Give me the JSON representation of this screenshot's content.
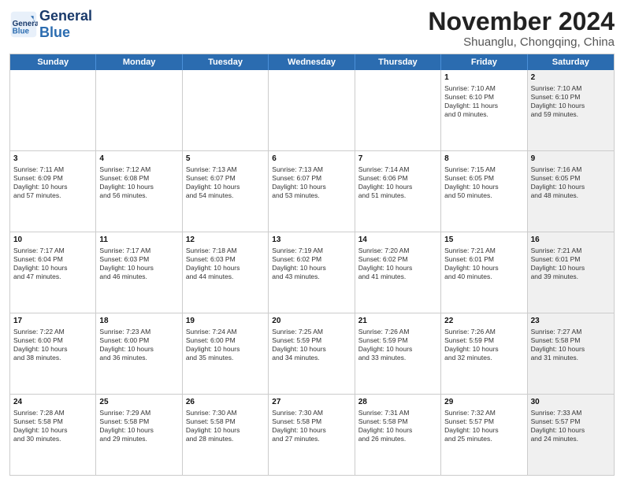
{
  "logo": {
    "text_general": "General",
    "text_blue": "Blue"
  },
  "title": "November 2024",
  "location": "Shuanglu, Chongqing, China",
  "header_days": [
    "Sunday",
    "Monday",
    "Tuesday",
    "Wednesday",
    "Thursday",
    "Friday",
    "Saturday"
  ],
  "rows": [
    [
      {
        "day": "",
        "text": "",
        "shaded": false
      },
      {
        "day": "",
        "text": "",
        "shaded": false
      },
      {
        "day": "",
        "text": "",
        "shaded": false
      },
      {
        "day": "",
        "text": "",
        "shaded": false
      },
      {
        "day": "",
        "text": "",
        "shaded": false
      },
      {
        "day": "1",
        "text": "Sunrise: 7:10 AM\nSunset: 6:10 PM\nDaylight: 11 hours\nand 0 minutes.",
        "shaded": false
      },
      {
        "day": "2",
        "text": "Sunrise: 7:10 AM\nSunset: 6:10 PM\nDaylight: 10 hours\nand 59 minutes.",
        "shaded": true
      }
    ],
    [
      {
        "day": "3",
        "text": "Sunrise: 7:11 AM\nSunset: 6:09 PM\nDaylight: 10 hours\nand 57 minutes.",
        "shaded": false
      },
      {
        "day": "4",
        "text": "Sunrise: 7:12 AM\nSunset: 6:08 PM\nDaylight: 10 hours\nand 56 minutes.",
        "shaded": false
      },
      {
        "day": "5",
        "text": "Sunrise: 7:13 AM\nSunset: 6:07 PM\nDaylight: 10 hours\nand 54 minutes.",
        "shaded": false
      },
      {
        "day": "6",
        "text": "Sunrise: 7:13 AM\nSunset: 6:07 PM\nDaylight: 10 hours\nand 53 minutes.",
        "shaded": false
      },
      {
        "day": "7",
        "text": "Sunrise: 7:14 AM\nSunset: 6:06 PM\nDaylight: 10 hours\nand 51 minutes.",
        "shaded": false
      },
      {
        "day": "8",
        "text": "Sunrise: 7:15 AM\nSunset: 6:05 PM\nDaylight: 10 hours\nand 50 minutes.",
        "shaded": false
      },
      {
        "day": "9",
        "text": "Sunrise: 7:16 AM\nSunset: 6:05 PM\nDaylight: 10 hours\nand 48 minutes.",
        "shaded": true
      }
    ],
    [
      {
        "day": "10",
        "text": "Sunrise: 7:17 AM\nSunset: 6:04 PM\nDaylight: 10 hours\nand 47 minutes.",
        "shaded": false
      },
      {
        "day": "11",
        "text": "Sunrise: 7:17 AM\nSunset: 6:03 PM\nDaylight: 10 hours\nand 46 minutes.",
        "shaded": false
      },
      {
        "day": "12",
        "text": "Sunrise: 7:18 AM\nSunset: 6:03 PM\nDaylight: 10 hours\nand 44 minutes.",
        "shaded": false
      },
      {
        "day": "13",
        "text": "Sunrise: 7:19 AM\nSunset: 6:02 PM\nDaylight: 10 hours\nand 43 minutes.",
        "shaded": false
      },
      {
        "day": "14",
        "text": "Sunrise: 7:20 AM\nSunset: 6:02 PM\nDaylight: 10 hours\nand 41 minutes.",
        "shaded": false
      },
      {
        "day": "15",
        "text": "Sunrise: 7:21 AM\nSunset: 6:01 PM\nDaylight: 10 hours\nand 40 minutes.",
        "shaded": false
      },
      {
        "day": "16",
        "text": "Sunrise: 7:21 AM\nSunset: 6:01 PM\nDaylight: 10 hours\nand 39 minutes.",
        "shaded": true
      }
    ],
    [
      {
        "day": "17",
        "text": "Sunrise: 7:22 AM\nSunset: 6:00 PM\nDaylight: 10 hours\nand 38 minutes.",
        "shaded": false
      },
      {
        "day": "18",
        "text": "Sunrise: 7:23 AM\nSunset: 6:00 PM\nDaylight: 10 hours\nand 36 minutes.",
        "shaded": false
      },
      {
        "day": "19",
        "text": "Sunrise: 7:24 AM\nSunset: 6:00 PM\nDaylight: 10 hours\nand 35 minutes.",
        "shaded": false
      },
      {
        "day": "20",
        "text": "Sunrise: 7:25 AM\nSunset: 5:59 PM\nDaylight: 10 hours\nand 34 minutes.",
        "shaded": false
      },
      {
        "day": "21",
        "text": "Sunrise: 7:26 AM\nSunset: 5:59 PM\nDaylight: 10 hours\nand 33 minutes.",
        "shaded": false
      },
      {
        "day": "22",
        "text": "Sunrise: 7:26 AM\nSunset: 5:59 PM\nDaylight: 10 hours\nand 32 minutes.",
        "shaded": false
      },
      {
        "day": "23",
        "text": "Sunrise: 7:27 AM\nSunset: 5:58 PM\nDaylight: 10 hours\nand 31 minutes.",
        "shaded": true
      }
    ],
    [
      {
        "day": "24",
        "text": "Sunrise: 7:28 AM\nSunset: 5:58 PM\nDaylight: 10 hours\nand 30 minutes.",
        "shaded": false
      },
      {
        "day": "25",
        "text": "Sunrise: 7:29 AM\nSunset: 5:58 PM\nDaylight: 10 hours\nand 29 minutes.",
        "shaded": false
      },
      {
        "day": "26",
        "text": "Sunrise: 7:30 AM\nSunset: 5:58 PM\nDaylight: 10 hours\nand 28 minutes.",
        "shaded": false
      },
      {
        "day": "27",
        "text": "Sunrise: 7:30 AM\nSunset: 5:58 PM\nDaylight: 10 hours\nand 27 minutes.",
        "shaded": false
      },
      {
        "day": "28",
        "text": "Sunrise: 7:31 AM\nSunset: 5:58 PM\nDaylight: 10 hours\nand 26 minutes.",
        "shaded": false
      },
      {
        "day": "29",
        "text": "Sunrise: 7:32 AM\nSunset: 5:57 PM\nDaylight: 10 hours\nand 25 minutes.",
        "shaded": false
      },
      {
        "day": "30",
        "text": "Sunrise: 7:33 AM\nSunset: 5:57 PM\nDaylight: 10 hours\nand 24 minutes.",
        "shaded": true
      }
    ]
  ]
}
